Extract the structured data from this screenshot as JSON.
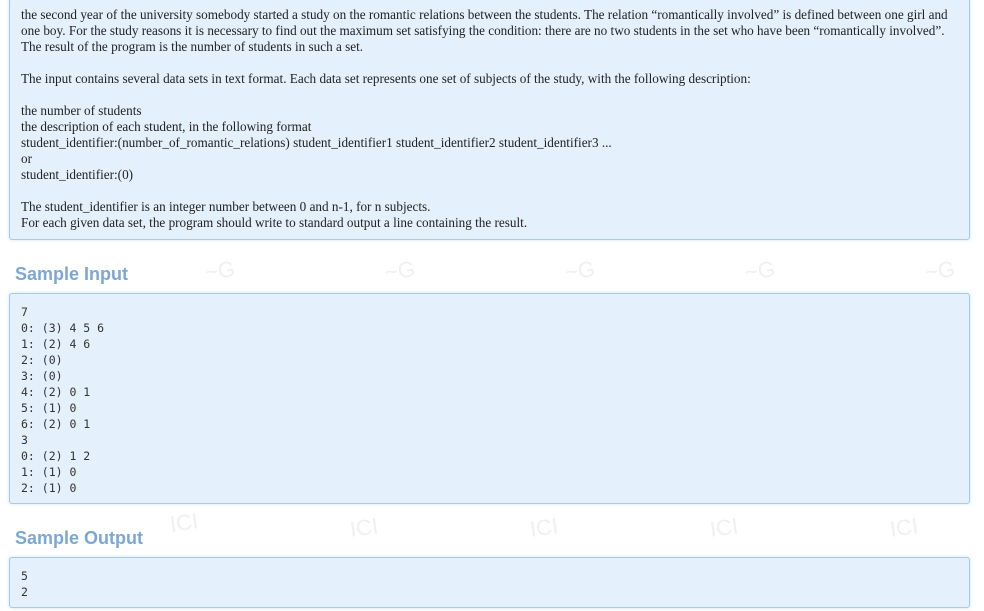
{
  "problem": {
    "description_lines": [
      "the second year of the university somebody started a study on the romantic relations between the students. The relation “romantically involved” is defined between one girl and one boy. For the study reasons it is necessary to find out the maximum set satisfying the condition: there are no two students in the set who have been “romantically involved”. The result of the program is the number of students in such a set.",
      "The input contains several data sets in text format. Each data set represents one set of subjects of the study, with the following description:",
      "the number of students",
      "the description of each student, in the following format",
      "student_identifier:(number_of_romantic_relations) student_identifier1 student_identifier2 student_identifier3 ...",
      "or",
      "student_identifier:(0)",
      "The student_identifier is an integer number between 0 and n-1, for n subjects.",
      "For each given data set, the program should write to standard output a line containing the result."
    ]
  },
  "sample_input": {
    "title": "Sample Input",
    "content": "7\n0: (3) 4 5 6\n1: (2) 4 6\n2: (0)\n3: (0)\n4: (2) 0 1\n5: (1) 0\n6: (2) 0 1\n3\n0: (2) 1 2\n1: (1) 0\n2: (1) 0"
  },
  "sample_output": {
    "title": "Sample Output",
    "content": "5\n2"
  },
  "colors": {
    "panel_background": "#e4f0fb",
    "panel_border": "#a6cbe6",
    "section_title": "#7ba7d4"
  }
}
